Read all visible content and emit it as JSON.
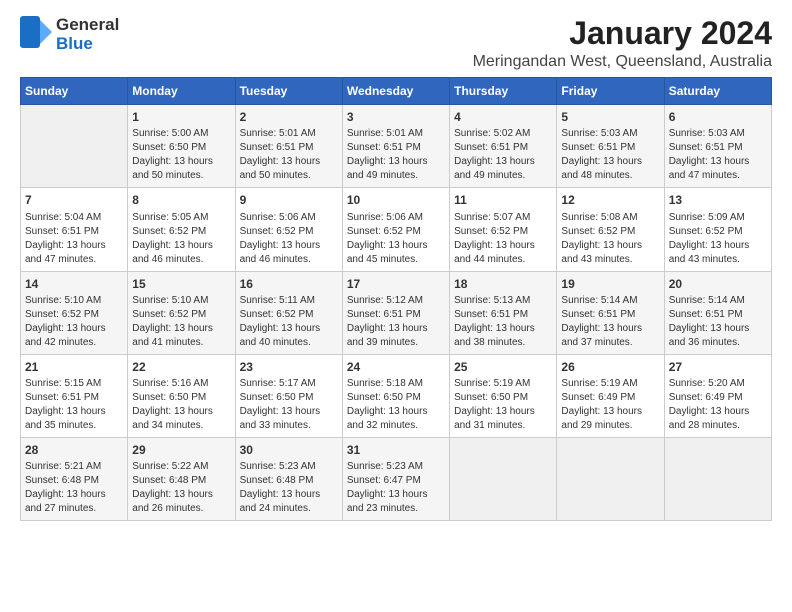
{
  "logo": {
    "general": "General",
    "blue": "Blue",
    "icon": "▶"
  },
  "header": {
    "title": "January 2024",
    "subtitle": "Meringandan West, Queensland, Australia"
  },
  "days_of_week": [
    "Sunday",
    "Monday",
    "Tuesday",
    "Wednesday",
    "Thursday",
    "Friday",
    "Saturday"
  ],
  "weeks": [
    [
      {
        "day": "",
        "content": ""
      },
      {
        "day": "1",
        "content": "Sunrise: 5:00 AM\nSunset: 6:50 PM\nDaylight: 13 hours\nand 50 minutes."
      },
      {
        "day": "2",
        "content": "Sunrise: 5:01 AM\nSunset: 6:51 PM\nDaylight: 13 hours\nand 50 minutes."
      },
      {
        "day": "3",
        "content": "Sunrise: 5:01 AM\nSunset: 6:51 PM\nDaylight: 13 hours\nand 49 minutes."
      },
      {
        "day": "4",
        "content": "Sunrise: 5:02 AM\nSunset: 6:51 PM\nDaylight: 13 hours\nand 49 minutes."
      },
      {
        "day": "5",
        "content": "Sunrise: 5:03 AM\nSunset: 6:51 PM\nDaylight: 13 hours\nand 48 minutes."
      },
      {
        "day": "6",
        "content": "Sunrise: 5:03 AM\nSunset: 6:51 PM\nDaylight: 13 hours\nand 47 minutes."
      }
    ],
    [
      {
        "day": "7",
        "content": "Sunrise: 5:04 AM\nSunset: 6:51 PM\nDaylight: 13 hours\nand 47 minutes."
      },
      {
        "day": "8",
        "content": "Sunrise: 5:05 AM\nSunset: 6:52 PM\nDaylight: 13 hours\nand 46 minutes."
      },
      {
        "day": "9",
        "content": "Sunrise: 5:06 AM\nSunset: 6:52 PM\nDaylight: 13 hours\nand 46 minutes."
      },
      {
        "day": "10",
        "content": "Sunrise: 5:06 AM\nSunset: 6:52 PM\nDaylight: 13 hours\nand 45 minutes."
      },
      {
        "day": "11",
        "content": "Sunrise: 5:07 AM\nSunset: 6:52 PM\nDaylight: 13 hours\nand 44 minutes."
      },
      {
        "day": "12",
        "content": "Sunrise: 5:08 AM\nSunset: 6:52 PM\nDaylight: 13 hours\nand 43 minutes."
      },
      {
        "day": "13",
        "content": "Sunrise: 5:09 AM\nSunset: 6:52 PM\nDaylight: 13 hours\nand 43 minutes."
      }
    ],
    [
      {
        "day": "14",
        "content": "Sunrise: 5:10 AM\nSunset: 6:52 PM\nDaylight: 13 hours\nand 42 minutes."
      },
      {
        "day": "15",
        "content": "Sunrise: 5:10 AM\nSunset: 6:52 PM\nDaylight: 13 hours\nand 41 minutes."
      },
      {
        "day": "16",
        "content": "Sunrise: 5:11 AM\nSunset: 6:52 PM\nDaylight: 13 hours\nand 40 minutes."
      },
      {
        "day": "17",
        "content": "Sunrise: 5:12 AM\nSunset: 6:51 PM\nDaylight: 13 hours\nand 39 minutes."
      },
      {
        "day": "18",
        "content": "Sunrise: 5:13 AM\nSunset: 6:51 PM\nDaylight: 13 hours\nand 38 minutes."
      },
      {
        "day": "19",
        "content": "Sunrise: 5:14 AM\nSunset: 6:51 PM\nDaylight: 13 hours\nand 37 minutes."
      },
      {
        "day": "20",
        "content": "Sunrise: 5:14 AM\nSunset: 6:51 PM\nDaylight: 13 hours\nand 36 minutes."
      }
    ],
    [
      {
        "day": "21",
        "content": "Sunrise: 5:15 AM\nSunset: 6:51 PM\nDaylight: 13 hours\nand 35 minutes."
      },
      {
        "day": "22",
        "content": "Sunrise: 5:16 AM\nSunset: 6:50 PM\nDaylight: 13 hours\nand 34 minutes."
      },
      {
        "day": "23",
        "content": "Sunrise: 5:17 AM\nSunset: 6:50 PM\nDaylight: 13 hours\nand 33 minutes."
      },
      {
        "day": "24",
        "content": "Sunrise: 5:18 AM\nSunset: 6:50 PM\nDaylight: 13 hours\nand 32 minutes."
      },
      {
        "day": "25",
        "content": "Sunrise: 5:19 AM\nSunset: 6:50 PM\nDaylight: 13 hours\nand 31 minutes."
      },
      {
        "day": "26",
        "content": "Sunrise: 5:19 AM\nSunset: 6:49 PM\nDaylight: 13 hours\nand 29 minutes."
      },
      {
        "day": "27",
        "content": "Sunrise: 5:20 AM\nSunset: 6:49 PM\nDaylight: 13 hours\nand 28 minutes."
      }
    ],
    [
      {
        "day": "28",
        "content": "Sunrise: 5:21 AM\nSunset: 6:48 PM\nDaylight: 13 hours\nand 27 minutes."
      },
      {
        "day": "29",
        "content": "Sunrise: 5:22 AM\nSunset: 6:48 PM\nDaylight: 13 hours\nand 26 minutes."
      },
      {
        "day": "30",
        "content": "Sunrise: 5:23 AM\nSunset: 6:48 PM\nDaylight: 13 hours\nand 24 minutes."
      },
      {
        "day": "31",
        "content": "Sunrise: 5:23 AM\nSunset: 6:47 PM\nDaylight: 13 hours\nand 23 minutes."
      },
      {
        "day": "",
        "content": ""
      },
      {
        "day": "",
        "content": ""
      },
      {
        "day": "",
        "content": ""
      }
    ]
  ]
}
